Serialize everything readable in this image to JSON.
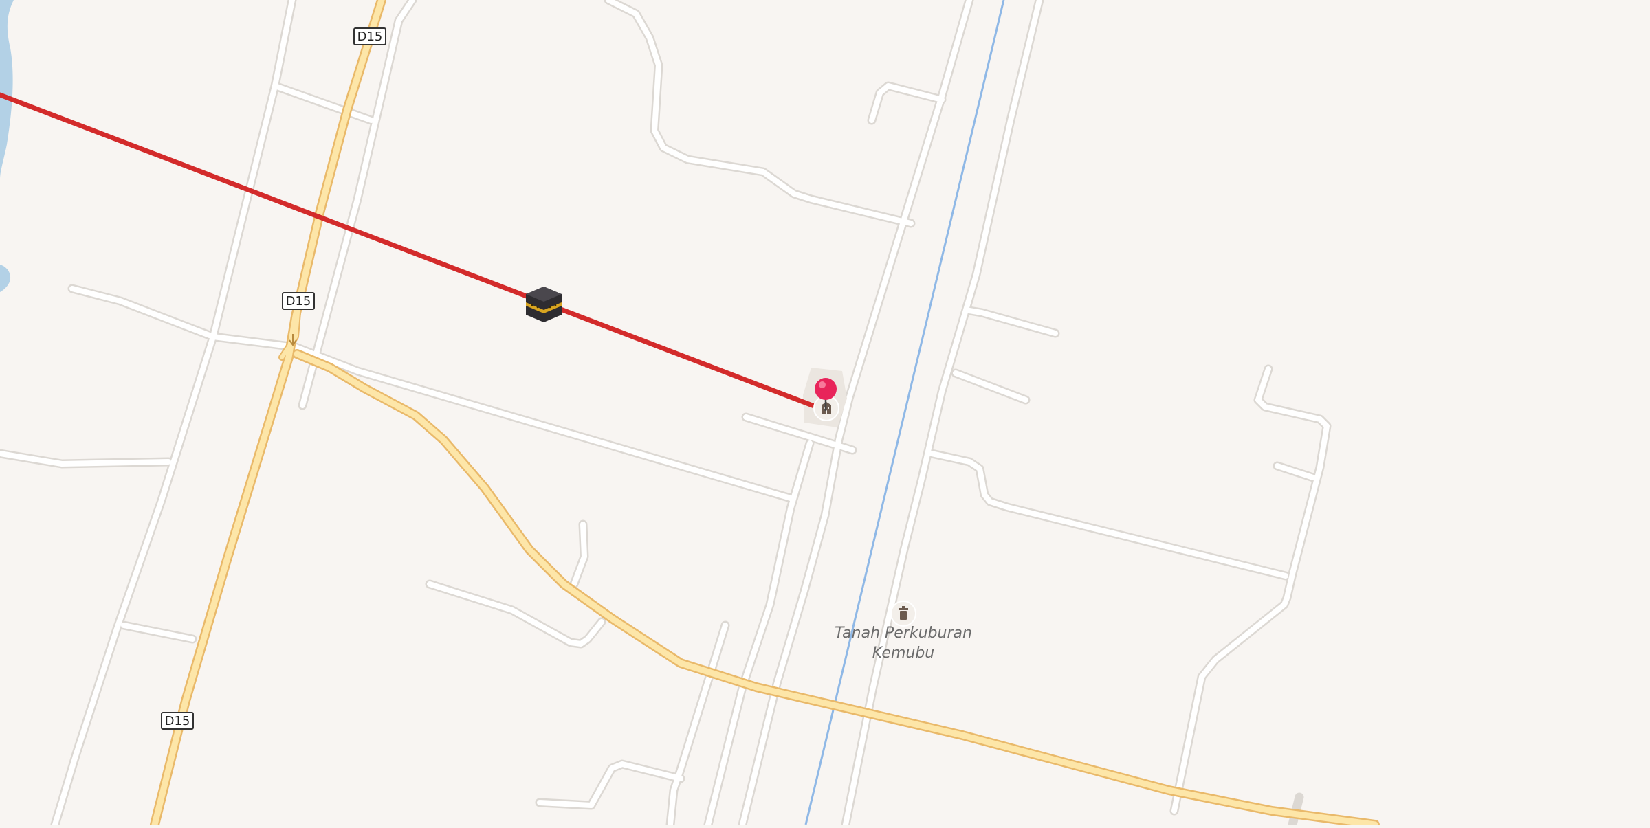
{
  "map": {
    "road_shields": [
      "D15",
      "D15",
      "D15"
    ],
    "poi": {
      "name_line1": "Tanah Perkuburan",
      "name_line2": "Kemubu",
      "icon": "cemetery-icon"
    },
    "markers": {
      "qibla_icon": "kaaba-icon",
      "location_pin": "location-pin-icon",
      "place_icon": "building-icon"
    },
    "colors": {
      "land": "#f8f5f2",
      "minor_road": "#ffffff",
      "minor_road_casing": "#dcd8d3",
      "main_road": "#fde6a8",
      "main_road_casing": "#e9b96a",
      "water": "#aacbe0",
      "railway_line": "#8fb8e6",
      "qibla_line": "#d32b2b",
      "pin": "#e8245a"
    }
  }
}
